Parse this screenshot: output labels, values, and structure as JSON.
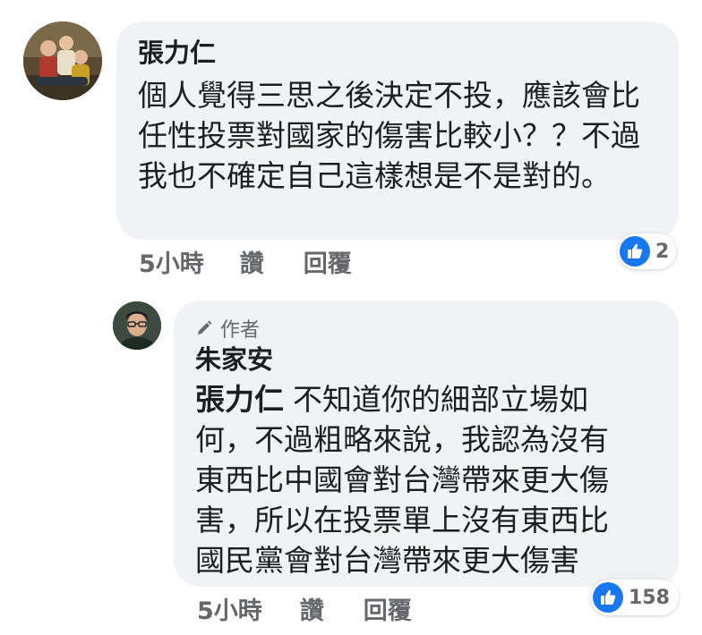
{
  "comments": [
    {
      "author": "張力仁",
      "text": "個人覺得三思之後決定不投，應該會比任性投票對國家的傷害比較小？？不過我也不確定自己這樣想是不是對的。",
      "time": "5小時",
      "like_label": "讚",
      "reply_label": "回覆",
      "reaction_count": "2"
    },
    {
      "badge": "作者",
      "author": "朱家安",
      "mention": "張力仁",
      "text": "不知道你的細部立場如何，不過粗略來說，我認為沒有東西比中國會對台灣帶來更大傷害，所以在投票單上沒有東西比國民黨會對台灣帶來更大傷害",
      "time": "5小時",
      "like_label": "讚",
      "reply_label": "回覆",
      "reaction_count": "158"
    }
  ],
  "icons": {
    "like": "thumbs-up-icon",
    "author_badge": "pencil-icon"
  },
  "colors": {
    "bubble": "#f0f2f5",
    "like_blue": "#1877f2",
    "meta_gray": "#65676b",
    "text": "#1c1e21"
  }
}
